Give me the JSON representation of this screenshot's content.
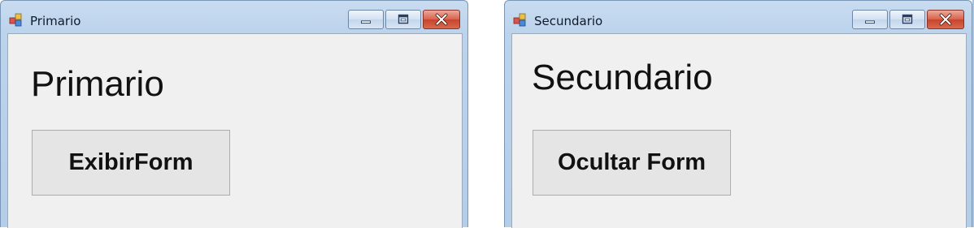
{
  "windows": [
    {
      "title": "Primario",
      "heading": "Primario",
      "button_label": "ExibirForm"
    },
    {
      "title": "Secundario",
      "heading": "Secundario",
      "button_label": "Ocultar Form"
    }
  ],
  "icons": {
    "app": "app-form-icon",
    "minimize": "minimize-icon",
    "maximize": "maximize-icon",
    "close": "close-icon"
  },
  "colors": {
    "client_bg": "#f0f0f0",
    "button_bg": "#e5e5e5",
    "close_red": "#c8432b",
    "titlebar_blue": "#bcd3ec"
  }
}
